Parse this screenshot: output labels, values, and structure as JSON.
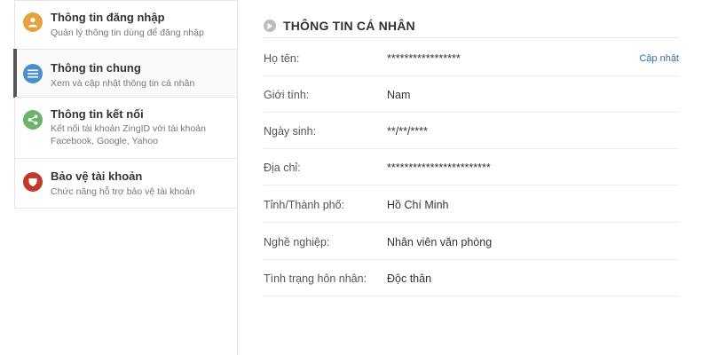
{
  "sidebar": {
    "items": [
      {
        "title": "Thông tin đăng nhập",
        "desc": [
          "Quản lý thông tin dùng để đăng nhập"
        ],
        "icon": "user-icon",
        "color": "#e6a23c",
        "active": false
      },
      {
        "title": "Thông tin chung",
        "desc": [
          "Xem và cập nhật thông tin cá nhân"
        ],
        "icon": "list-icon",
        "color": "#4a90c8",
        "active": true
      },
      {
        "title": "Thông tin kết nối",
        "desc": [
          "Kết nối tài khoản ZingID với tài khoản",
          "Facebook, Google, Yahoo"
        ],
        "icon": "share-icon",
        "color": "#6cb46a",
        "active": false
      },
      {
        "title": "Bảo vệ tài khoản",
        "desc": [
          "Chức năng hỗ trợ bảo vệ tài khoản"
        ],
        "icon": "shield-icon",
        "color": "#c0392b",
        "active": false
      }
    ]
  },
  "main": {
    "section_title": "THÔNG TIN CÁ NHÂN",
    "rows": [
      {
        "label": "Họ tên:",
        "value": "*****************",
        "action": "Cập nhật"
      },
      {
        "label": "Giới tính:",
        "value": "Nam"
      },
      {
        "label": "Ngày sinh:",
        "value": "**/**/****"
      },
      {
        "label": "Địa chỉ:",
        "value": "************************"
      },
      {
        "label": "Tỉnh/Thành phố:",
        "value": "Hồ Chí Minh"
      },
      {
        "label": "Nghề nghiệp:",
        "value": "Nhân viên văn phòng"
      },
      {
        "label": "Tình trạng hôn nhân:",
        "value": "Độc thân"
      }
    ]
  }
}
